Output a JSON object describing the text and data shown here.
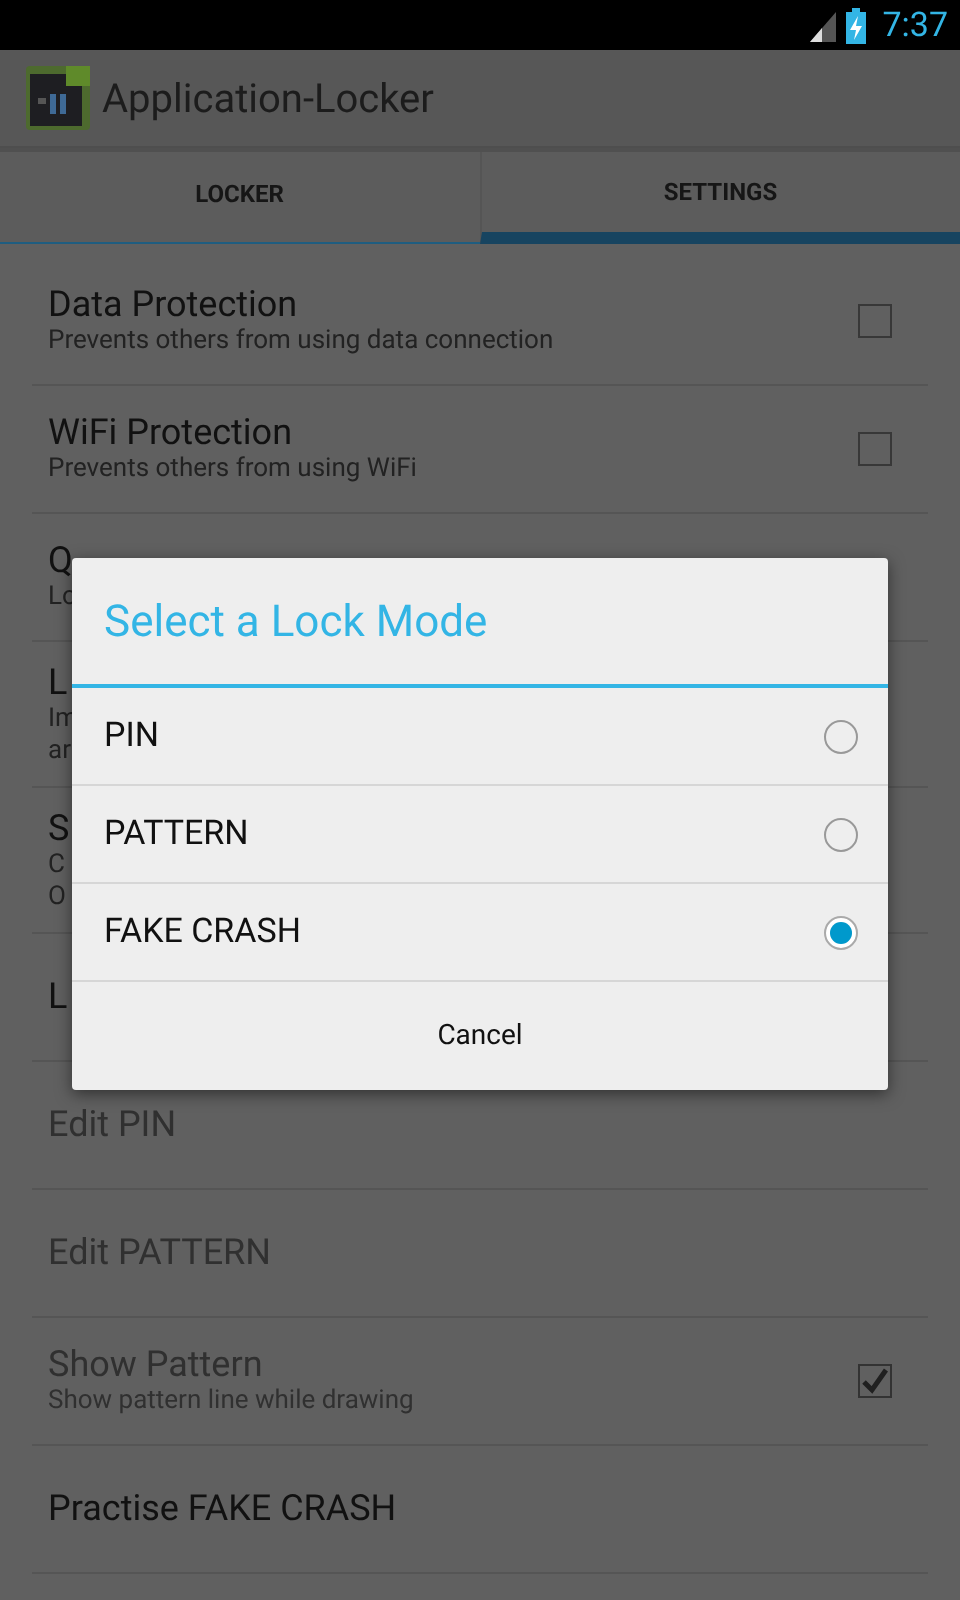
{
  "status_bar": {
    "time": "7:37"
  },
  "action_bar": {
    "title": "Application-Locker"
  },
  "tabs": [
    {
      "label": "LOCKER",
      "selected": false
    },
    {
      "label": "SETTINGS",
      "selected": true
    }
  ],
  "settings": [
    {
      "kind": "checkbox",
      "title": "Data Protection",
      "summary": [
        "Prevents others from using data connection"
      ],
      "checked": false,
      "disabled": false
    },
    {
      "kind": "checkbox",
      "title": "WiFi Protection",
      "summary": [
        "Prevents others from using WiFi"
      ],
      "checked": false,
      "disabled": false
    },
    {
      "kind": "plain",
      "title": "Q",
      "summary": [
        "Lo"
      ],
      "disabled": false
    },
    {
      "kind": "plain",
      "title": "L",
      "summary": [
        "Im",
        "ar"
      ],
      "disabled": false
    },
    {
      "kind": "plain",
      "title": "S",
      "summary": [
        "C",
        "O"
      ],
      "disabled": false
    },
    {
      "kind": "plain",
      "title": "L",
      "disabled": false
    },
    {
      "kind": "plain",
      "title": "Edit PIN",
      "disabled": true
    },
    {
      "kind": "plain",
      "title": "Edit PATTERN",
      "disabled": true
    },
    {
      "kind": "checkbox",
      "title": "Show Pattern",
      "summary": [
        "Show pattern line while drawing"
      ],
      "checked": true,
      "disabled": true
    },
    {
      "kind": "plain",
      "title": "Practise FAKE CRASH",
      "disabled": false
    }
  ],
  "dialog": {
    "title": "Select a Lock Mode",
    "options": [
      {
        "label": "PIN",
        "selected": false
      },
      {
        "label": "PATTERN",
        "selected": false
      },
      {
        "label": "FAKE CRASH",
        "selected": true
      }
    ],
    "cancel": "Cancel"
  }
}
